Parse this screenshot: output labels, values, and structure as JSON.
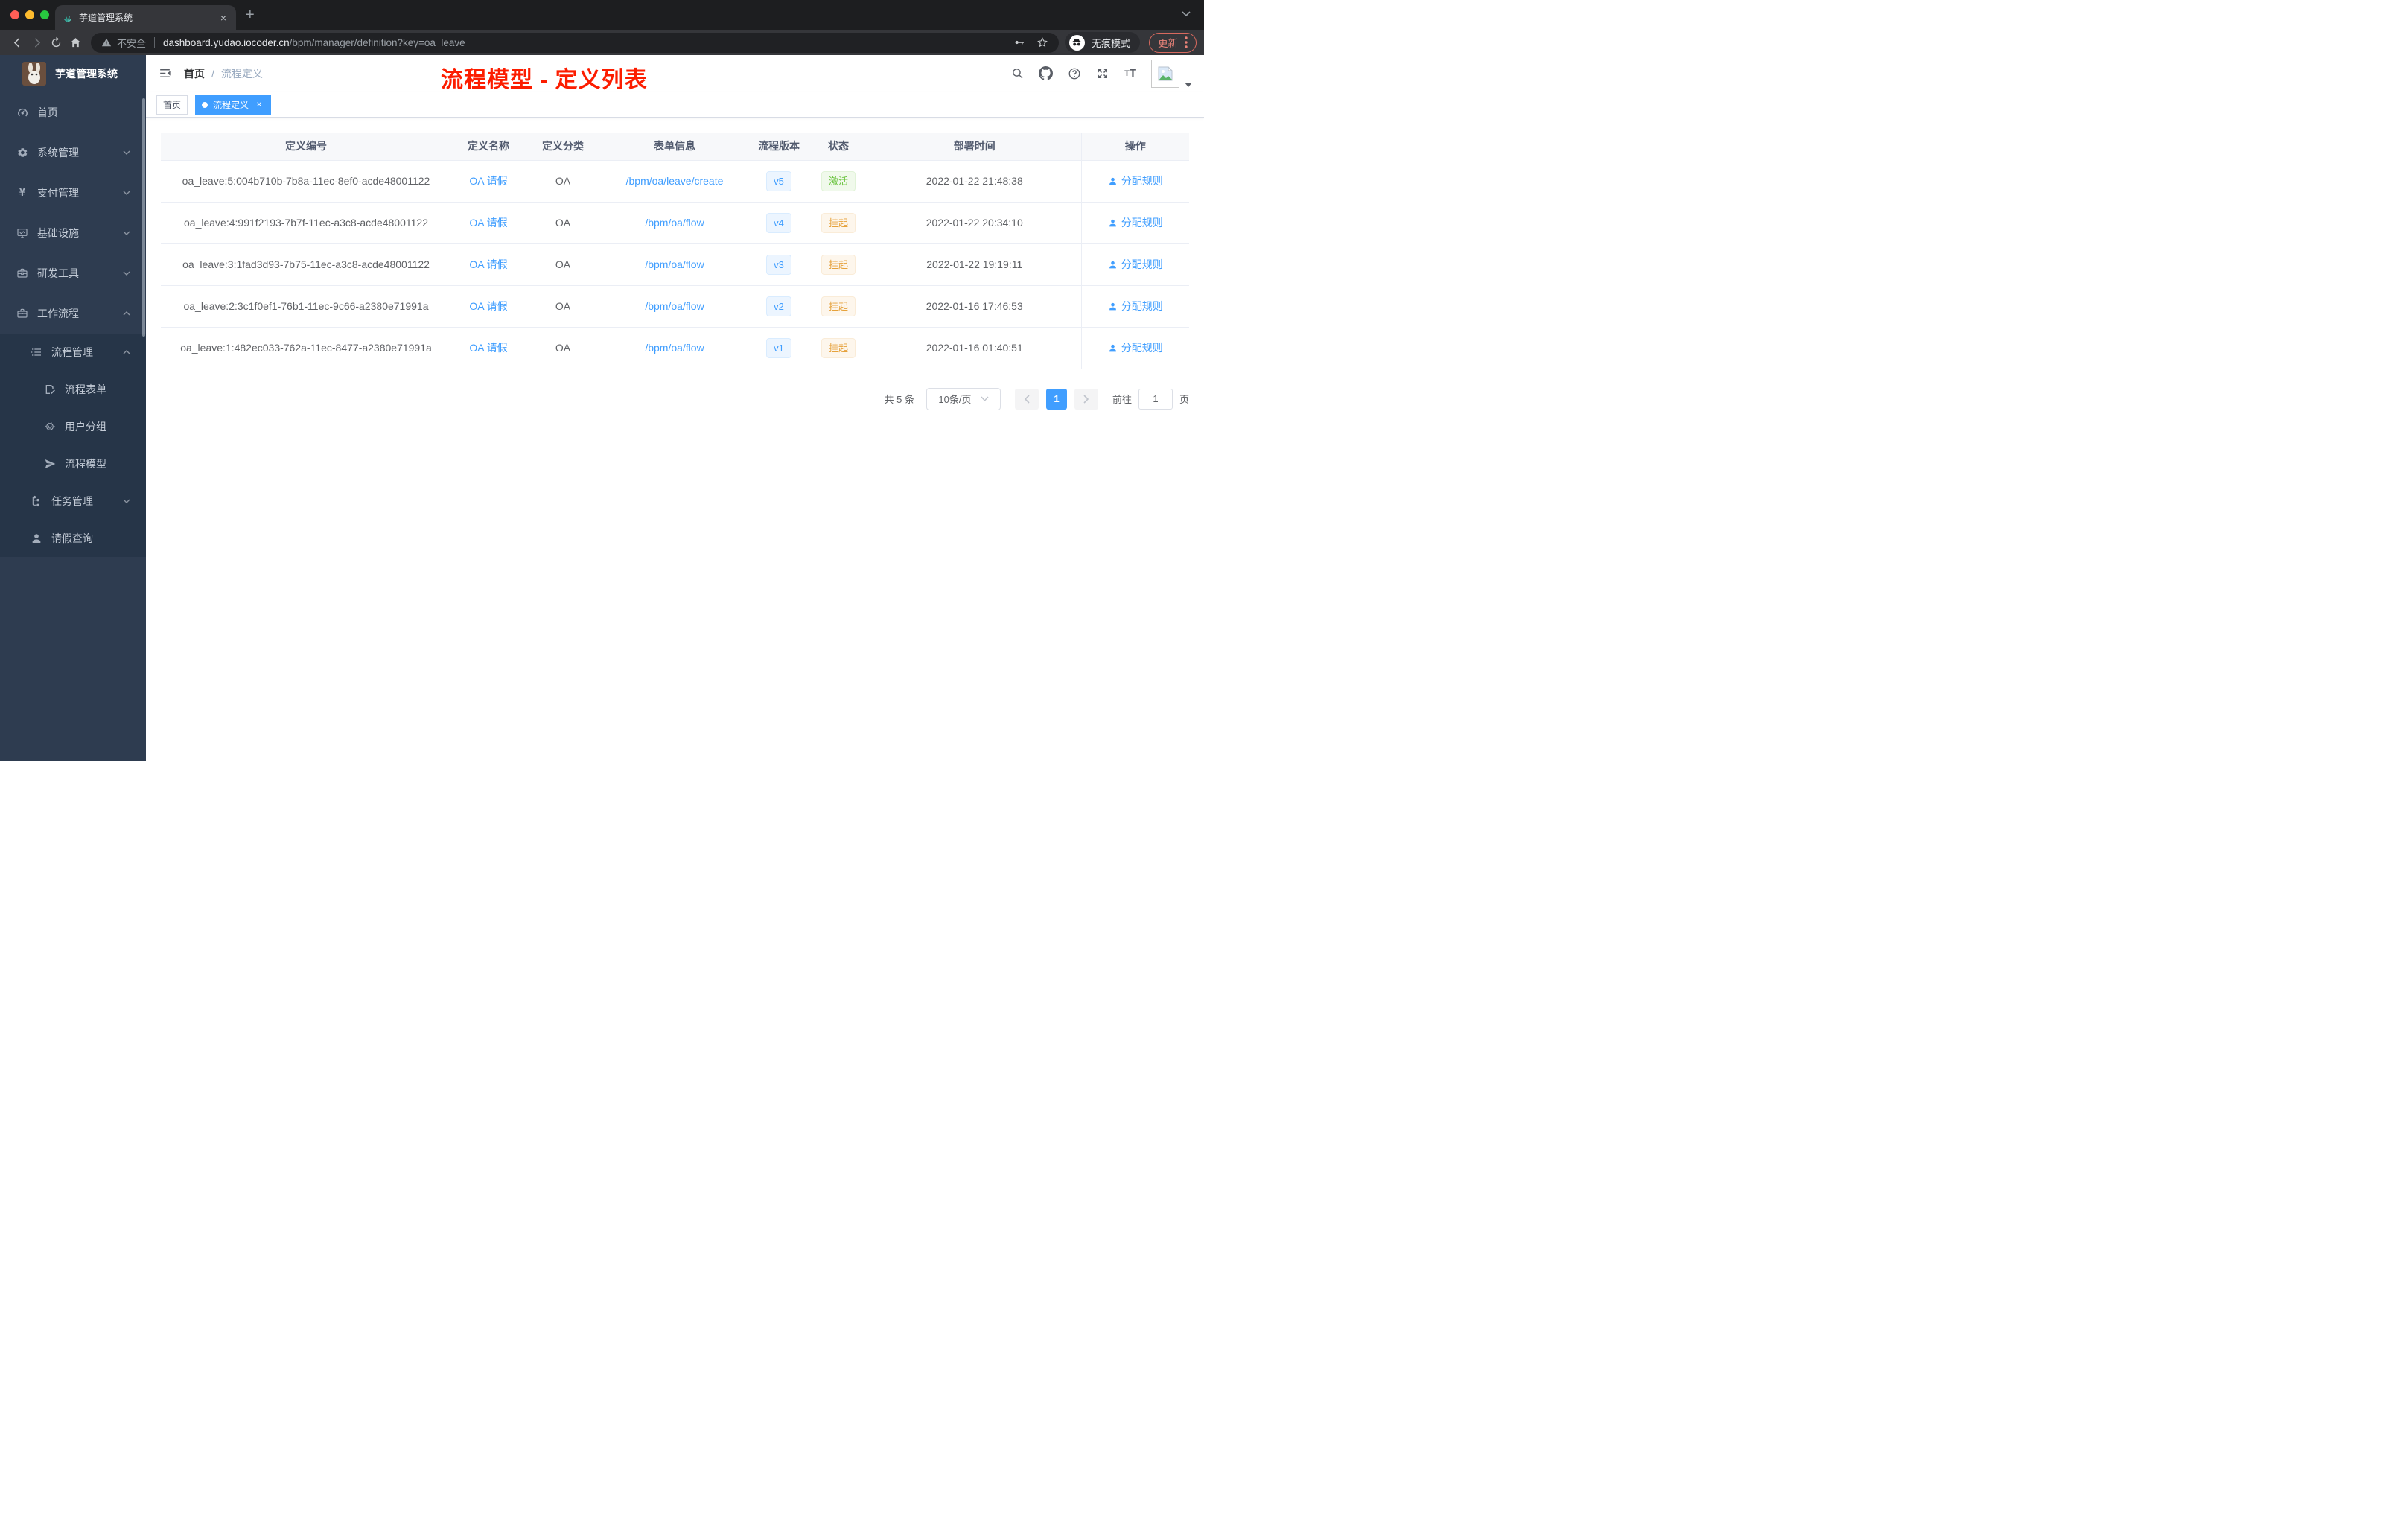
{
  "browser": {
    "tab_title": "芋道管理系统",
    "security_label": "不安全",
    "url_host": "dashboard.yudao.iocoder.cn",
    "url_path": "/bpm/manager/definition?key=oa_leave",
    "incognito_label": "无痕模式",
    "update_label": "更新"
  },
  "sidebar": {
    "logo_title": "芋道管理系统",
    "items": [
      {
        "key": "home",
        "label": "首页",
        "icon": "dashboard-icon",
        "level": 1,
        "in_sub": false
      },
      {
        "key": "system",
        "label": "系统管理",
        "icon": "gear-icon",
        "level": 1,
        "arrow": "down",
        "in_sub": false
      },
      {
        "key": "payment",
        "label": "支付管理",
        "icon": "yen-icon",
        "level": 1,
        "arrow": "down",
        "in_sub": false
      },
      {
        "key": "infra",
        "label": "基础设施",
        "icon": "monitor-icon",
        "level": 1,
        "arrow": "down",
        "in_sub": false
      },
      {
        "key": "devtools",
        "label": "研发工具",
        "icon": "toolbox-icon",
        "level": 1,
        "arrow": "down",
        "in_sub": false
      },
      {
        "key": "workflow",
        "label": "工作流程",
        "icon": "briefcase-icon",
        "level": 1,
        "arrow": "up",
        "in_sub": false
      },
      {
        "key": "process-manage",
        "label": "流程管理",
        "icon": "list-icon",
        "level": 2,
        "arrow": "up",
        "in_sub": true
      },
      {
        "key": "process-form",
        "label": "流程表单",
        "icon": "form-icon",
        "level": 3,
        "in_sub": true
      },
      {
        "key": "user-group",
        "label": "用户分组",
        "icon": "robot-icon",
        "level": 3,
        "in_sub": true
      },
      {
        "key": "process-model",
        "label": "流程模型",
        "icon": "paper-plane-icon",
        "level": 3,
        "in_sub": true
      },
      {
        "key": "task-manage",
        "label": "任务管理",
        "icon": "tree-icon",
        "level": 2,
        "arrow": "down",
        "in_sub": true
      },
      {
        "key": "leave-query",
        "label": "请假查询",
        "icon": "user-icon",
        "level": 2,
        "in_sub": true
      }
    ]
  },
  "header": {
    "breadcrumb": {
      "home": "首页",
      "separator": "/",
      "current": "流程定义"
    },
    "annotation": "流程模型 - 定义列表"
  },
  "tags": [
    {
      "key": "home",
      "label": "首页",
      "active": false,
      "closable": false
    },
    {
      "key": "process-definition",
      "label": "流程定义",
      "active": true,
      "closable": true
    }
  ],
  "table": {
    "columns": [
      "定义编号",
      "定义名称",
      "定义分类",
      "表单信息",
      "流程版本",
      "状态",
      "部署时间",
      "操作"
    ],
    "rows": [
      {
        "id": "oa_leave:5:004b710b-7b8a-11ec-8ef0-acde48001122",
        "name": "OA 请假",
        "category": "OA",
        "form": "/bpm/oa/leave/create",
        "version": "v5",
        "status": "激活",
        "status_type": "success",
        "deploy_time": "2022-01-22 21:48:38",
        "action": "分配规则"
      },
      {
        "id": "oa_leave:4:991f2193-7b7f-11ec-a3c8-acde48001122",
        "name": "OA 请假",
        "category": "OA",
        "form": "/bpm/oa/flow",
        "version": "v4",
        "status": "挂起",
        "status_type": "warning",
        "deploy_time": "2022-01-22 20:34:10",
        "action": "分配规则"
      },
      {
        "id": "oa_leave:3:1fad3d93-7b75-11ec-a3c8-acde48001122",
        "name": "OA 请假",
        "category": "OA",
        "form": "/bpm/oa/flow",
        "version": "v3",
        "status": "挂起",
        "status_type": "warning",
        "deploy_time": "2022-01-22 19:19:11",
        "action": "分配规则"
      },
      {
        "id": "oa_leave:2:3c1f0ef1-76b1-11ec-9c66-a2380e71991a",
        "name": "OA 请假",
        "category": "OA",
        "form": "/bpm/oa/flow",
        "version": "v2",
        "status": "挂起",
        "status_type": "warning",
        "deploy_time": "2022-01-16 17:46:53",
        "action": "分配规则"
      },
      {
        "id": "oa_leave:1:482ec033-762a-11ec-8477-a2380e71991a",
        "name": "OA 请假",
        "category": "OA",
        "form": "/bpm/oa/flow",
        "version": "v1",
        "status": "挂起",
        "status_type": "warning",
        "deploy_time": "2022-01-16 01:40:51",
        "action": "分配规则"
      }
    ]
  },
  "pagination": {
    "total_label": "共 5 条",
    "page_size": "10条/页",
    "current_page": "1",
    "goto_label": "前往",
    "goto_value": "1",
    "page_unit": "页"
  },
  "colors": {
    "accent_blue": "#409eff",
    "annotation_red": "#fc1d00",
    "success_green": "#67c23a",
    "warning_orange": "#e6a23c",
    "sidebar_bg": "#2e3c50",
    "sidebar_submenu_bg": "#263548",
    "update_salmon": "#ea8379"
  }
}
